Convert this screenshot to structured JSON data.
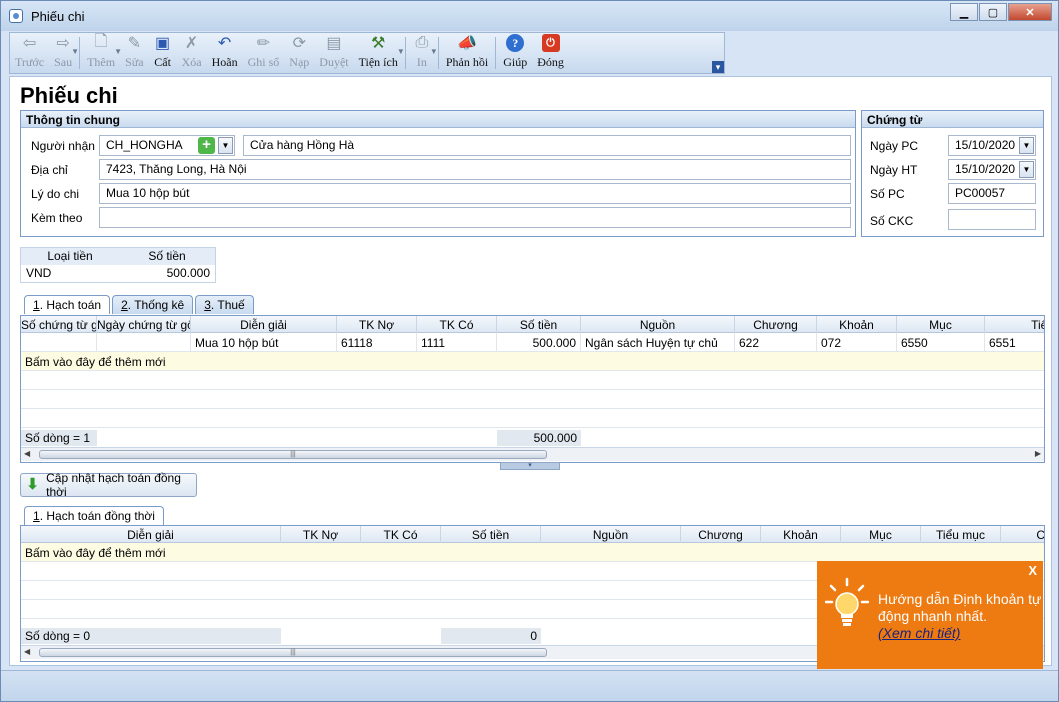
{
  "window": {
    "title": "Phiếu chi",
    "min_icon": "minimize-icon",
    "max_icon": "maximize-icon",
    "close_icon": "close-icon"
  },
  "toolbar": {
    "buttons": [
      {
        "label": "Trước",
        "icon": "arrow-left-icon",
        "enabled": false
      },
      {
        "label": "Sau",
        "icon": "arrow-right-icon",
        "enabled": false
      },
      {
        "label": "Thêm",
        "icon": "document-new-icon",
        "enabled": false
      },
      {
        "label": "Sửa",
        "icon": "document-edit-icon",
        "enabled": false
      },
      {
        "label": "Cất",
        "icon": "save-icon",
        "enabled": true
      },
      {
        "label": "Xóa",
        "icon": "delete-icon",
        "enabled": false
      },
      {
        "label": "Hoãn",
        "icon": "undo-icon",
        "enabled": true
      },
      {
        "label": "Ghi sổ",
        "icon": "pencil-icon",
        "enabled": false
      },
      {
        "label": "Nạp",
        "icon": "reload-icon",
        "enabled": false
      },
      {
        "label": "Duyệt",
        "icon": "approve-icon",
        "enabled": false
      },
      {
        "label": "Tiện ích",
        "icon": "tools-icon",
        "enabled": true
      },
      {
        "label": "In",
        "icon": "print-icon",
        "enabled": false
      },
      {
        "label": "Phản hồi",
        "icon": "megaphone-icon",
        "enabled": true
      },
      {
        "label": "Giúp",
        "icon": "help-icon",
        "enabled": true
      },
      {
        "label": "Đóng",
        "icon": "power-icon",
        "enabled": true
      }
    ]
  },
  "page_title": "Phiếu chi",
  "general": {
    "header": "Thông tin chung",
    "recipient_label": "Người nhận",
    "recipient_code": "CH_HONGHA",
    "recipient_name": "Cửa hàng Hồng Hà",
    "address_label": "Địa chỉ",
    "address": "7423, Thăng Long, Hà Nội",
    "reason_label": "Lý do chi",
    "reason": "Mua 10 hộp bút",
    "attach_label": "Kèm theo",
    "attach": ""
  },
  "voucher": {
    "header": "Chứng từ",
    "date_pc_label": "Ngày PC",
    "date_pc": "15/10/2020",
    "date_ht_label": "Ngày HT",
    "date_ht": "15/10/2020",
    "no_pc_label": "Số PC",
    "no_pc": "PC00057",
    "no_ckc_label": "Số CKC",
    "no_ckc": ""
  },
  "currency": {
    "col_type": "Loại tiền",
    "col_amount": "Số tiền",
    "type": "VND",
    "amount": "500.000"
  },
  "tabs1": [
    {
      "num": "1",
      "label": ". Hạch toán"
    },
    {
      "num": "2",
      "label": ". Thống kê"
    },
    {
      "num": "3",
      "label": ". Thuế"
    }
  ],
  "grid1": {
    "columns": [
      "Số chứng từ g",
      "Ngày chứng từ gố",
      "Diễn giải",
      "TK Nợ",
      "TK Có",
      "Số tiền",
      "Nguồn",
      "Chương",
      "Khoản",
      "Mục",
      "Tiểu"
    ],
    "rows": [
      [
        "",
        "",
        "Mua 10 hộp bút",
        "61118",
        "1111",
        "500.000",
        "Ngân sách Huyện tự chủ",
        "622",
        "072",
        "6550",
        "6551"
      ]
    ],
    "add_text": "Bấm vào đây để thêm mới",
    "footer_count": "Số dòng = 1",
    "footer_total": "500.000"
  },
  "update_button": "Cập nhật hạch toán đồng thời",
  "tabs2": [
    {
      "num": "1",
      "label": ". Hạch toán đồng thời"
    }
  ],
  "grid2": {
    "columns": [
      "Diễn giải",
      "TK Nợ",
      "TK Có",
      "Số tiền",
      "Nguồn",
      "Chương",
      "Khoản",
      "Mục",
      "Tiểu mục",
      "C"
    ],
    "add_text": "Bấm vào đây để thêm mới",
    "footer_count": "Số dòng = 0",
    "footer_total": "0"
  },
  "popup": {
    "message": "Hướng dẫn Định khoản tự động nhanh nhất.",
    "link": "(Xem chi tiết)",
    "close": "X"
  },
  "colors": {
    "accent": "#2b56a0",
    "popup": "#ee7a12",
    "add_row": "#fdfbe1"
  }
}
